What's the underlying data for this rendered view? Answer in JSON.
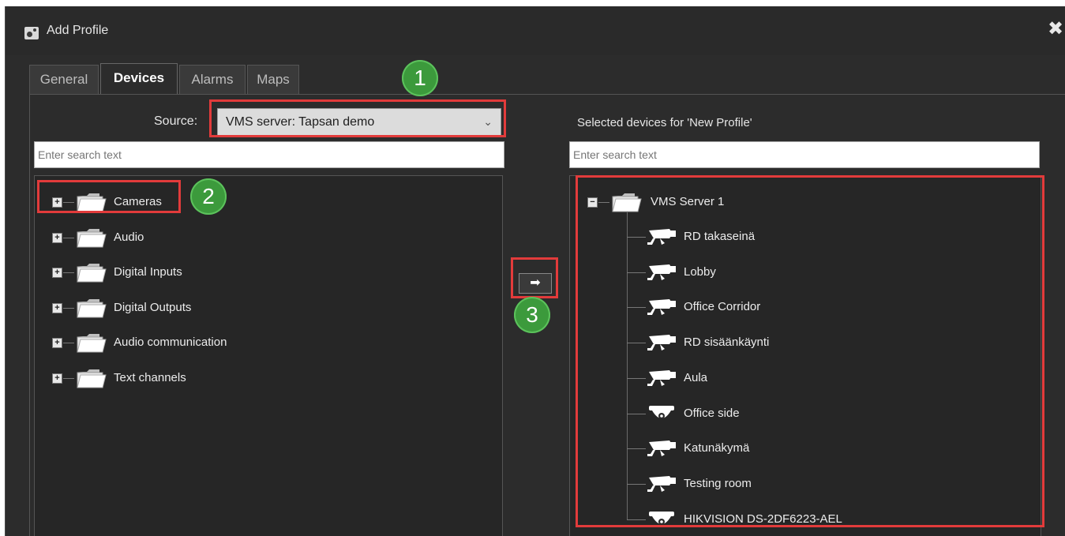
{
  "window": {
    "title": "Add Profile",
    "close_glyph": "✖"
  },
  "tabs": [
    {
      "label": "General",
      "active": false
    },
    {
      "label": "Devices",
      "active": true
    },
    {
      "label": "Alarms",
      "active": false
    },
    {
      "label": "Maps",
      "active": false
    }
  ],
  "source": {
    "label": "Source:",
    "value": "VMS server: Tapsan demo"
  },
  "right_header": "Selected devices for 'New Profile'",
  "search_left": {
    "placeholder": "Enter search text"
  },
  "search_right": {
    "placeholder": "Enter search text"
  },
  "left_tree": [
    {
      "label": "Cameras",
      "expander": "+"
    },
    {
      "label": "Audio",
      "expander": "+"
    },
    {
      "label": "Digital Inputs",
      "expander": "+"
    },
    {
      "label": "Digital Outputs",
      "expander": "+"
    },
    {
      "label": "Audio communication",
      "expander": "+"
    },
    {
      "label": "Text channels",
      "expander": "+"
    }
  ],
  "right_tree": {
    "root": {
      "label": "VMS Server 1",
      "expander": "−"
    },
    "children": [
      {
        "label": "RD takaseinä",
        "icon": "bullet-camera-icon"
      },
      {
        "label": "Lobby",
        "icon": "bullet-camera-icon"
      },
      {
        "label": "Office Corridor",
        "icon": "bullet-camera-icon"
      },
      {
        "label": "RD sisäänkäynti",
        "icon": "bullet-camera-icon"
      },
      {
        "label": "Aula",
        "icon": "bullet-camera-icon"
      },
      {
        "label": "Office side",
        "icon": "dome-camera-icon"
      },
      {
        "label": "Katunäkymä",
        "icon": "bullet-camera-icon"
      },
      {
        "label": "Testing room",
        "icon": "bullet-camera-icon"
      },
      {
        "label": "HIKVISION DS-2DF6223-AEL",
        "icon": "dome-camera-icon"
      }
    ]
  },
  "arrow_button": "➡",
  "annotations": [
    "1",
    "2",
    "3"
  ],
  "colors": {
    "annotation_box": "#e23b3b",
    "annotation_badge": "#3c9a3c",
    "background": "#2c2c2c"
  }
}
